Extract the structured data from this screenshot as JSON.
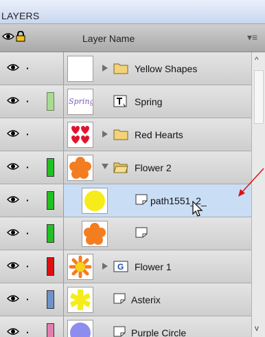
{
  "panel": {
    "title": "LAYERS",
    "header": {
      "column_label": "Layer Name",
      "menu_icon": "panel-menu-icon",
      "eye_icon": "eye-icon",
      "lock_icon": "lock-icon"
    }
  },
  "layers": [
    {
      "name": "Yellow Shapes",
      "type": "group-folder",
      "expandable": true,
      "expanded": false,
      "thumbnail": "blank",
      "color": "",
      "selected": false
    },
    {
      "name": "Spring",
      "type": "text",
      "expandable": false,
      "expanded": false,
      "thumbnail": "spring-text",
      "thumb_text": "Spring",
      "color": "#8fd07a",
      "selected": false
    },
    {
      "name": "Red Hearts",
      "type": "group-folder",
      "expandable": true,
      "expanded": false,
      "thumbnail": "hearts",
      "color": "",
      "selected": false
    },
    {
      "name": "Flower 2",
      "type": "group-folder-open",
      "expandable": true,
      "expanded": true,
      "thumbnail": "orange-flower",
      "color": "#22c122",
      "selected": false
    },
    {
      "name": "path1551_2_",
      "type": "path",
      "expandable": false,
      "expanded": false,
      "thumbnail": "yellow-circle",
      "color": "#22c122",
      "selected": true,
      "indent": true
    },
    {
      "name": "",
      "type": "path",
      "expandable": false,
      "expanded": false,
      "thumbnail": "orange-flower",
      "color": "#22c122",
      "selected": false,
      "indent": true
    },
    {
      "name": "Flower 1",
      "type": "group",
      "expandable": true,
      "expanded": false,
      "thumbnail": "orange-sunflower",
      "color": "#e01010",
      "selected": false
    },
    {
      "name": "Asterix",
      "type": "path",
      "expandable": false,
      "expanded": false,
      "thumbnail": "yellow-asterix",
      "color": "#6f93c8",
      "selected": false
    },
    {
      "name": "Purple Circle",
      "type": "path",
      "expandable": false,
      "expanded": false,
      "thumbnail": "purple-circle",
      "color": "#e37fb0",
      "selected": false
    }
  ],
  "colors": {
    "selected_row": "#c9def5",
    "annotation_arrow": "#e01010"
  }
}
